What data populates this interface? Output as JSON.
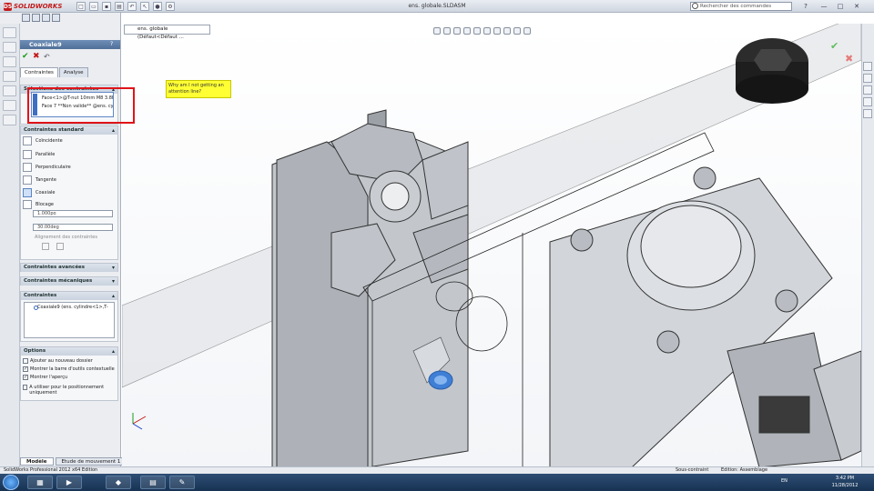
{
  "app": {
    "brand": "SOLIDWORKS",
    "document_title": "ens. globale.SLDASM",
    "search_placeholder": "Rechercher des commandes",
    "window_buttons": [
      "?",
      "—",
      "□",
      "✕"
    ]
  },
  "property_manager": {
    "title": "Coaxiale9",
    "help": "?",
    "tabs": [
      {
        "label": "Contraintes",
        "active": true
      },
      {
        "label": "Analyse",
        "active": false
      }
    ],
    "selection_group": {
      "title": "Sélections des contraintes",
      "items": [
        "Face<1>@T-nut 10mm M8 3.8H",
        "Face 7 **Non valide** @ens. cy"
      ]
    },
    "standard_group": {
      "title": "Contraintes standard",
      "mates": [
        {
          "label": "Coïncidente",
          "selected": false
        },
        {
          "label": "Parallèle",
          "selected": false
        },
        {
          "label": "Perpendiculaire",
          "selected": false
        },
        {
          "label": "Tangente",
          "selected": false
        },
        {
          "label": "Coaxiale",
          "selected": true
        },
        {
          "label": "Blocage",
          "selected": false
        }
      ],
      "distance_value": "1.000po",
      "angle_value": "30.00deg",
      "alignment_label": "Alignement des contraintes"
    },
    "advanced_group": {
      "title": "Contraintes avancées"
    },
    "mechanical_group": {
      "title": "Contraintes mécaniques"
    },
    "mates_group": {
      "title": "Contraintes",
      "items": [
        "Coaxiale9 (ens. cylindre<1>,T-"
      ]
    },
    "options_group": {
      "title": "Options",
      "options": [
        {
          "label": "Ajouter au nouveau dossier",
          "checked": false
        },
        {
          "label": "Montrer la barre d'outils contextuelle",
          "checked": true
        },
        {
          "label": "Montrer l'aperçu",
          "checked": true
        },
        {
          "label": "A utiliser pour le positionnement uniquement",
          "checked": false
        }
      ]
    }
  },
  "viewport": {
    "doc_tab": "ens. globale (Défaut<Défaut ...",
    "annotation": "Why am I not getting an attention line?"
  },
  "bottom_tabs": [
    {
      "label": "Modèle",
      "active": true
    },
    {
      "label": "Etude de mouvement 1",
      "active": false
    }
  ],
  "status": {
    "left": "SolidWorks Professional 2012 x64 Edition",
    "center": "Sous-contraint",
    "right": "Edition: Assemblage"
  },
  "taskbar": {
    "lang": "EN",
    "time": "3:42 PM",
    "date": "11/28/2012"
  },
  "colors": {
    "accent": "#4f6f98",
    "annotation_bg": "#ffff33",
    "highlight_red": "#e0141a",
    "selected_face": "#3f7fd6"
  }
}
